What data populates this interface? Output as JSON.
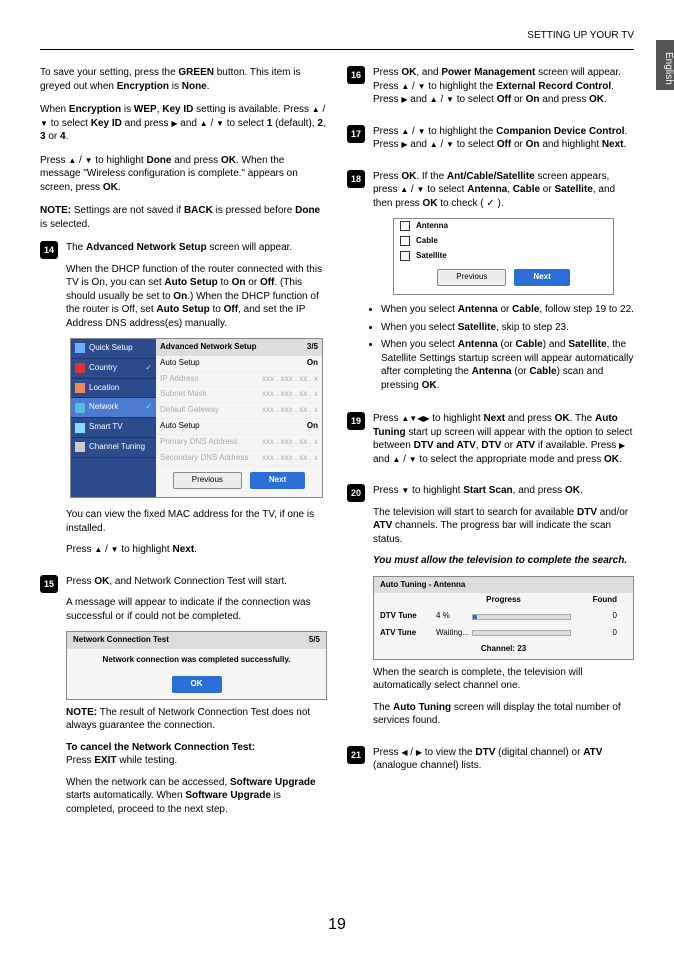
{
  "header": {
    "section": "SETTING UP YOUR TV",
    "lang_tab": "English"
  },
  "left": {
    "p1_a": "To save your setting, press the ",
    "p1_b": " button. This item is greyed out when ",
    "p1_c": " is ",
    "p1_d": ".",
    "green": "GREEN",
    "enc": "Encryption",
    "none": "None",
    "p2_a": "When ",
    "p2_b": " is ",
    "p2_c": ", ",
    "p2_d": " setting is available. Press ",
    "p2_e": " to select ",
    "p2_f": " and press ",
    "p2_g": " and ",
    "p2_h": " to select ",
    "p2_i": " (default), ",
    "p2_j": " or ",
    "p2_k": ".",
    "wep": "WEP",
    "keyid": "Key ID",
    "one": "1",
    "two": "2",
    "three": "3",
    "four": "4",
    "p3_a": "Press ",
    "p3_b": " to highlight ",
    "p3_c": " and press ",
    "p3_d": ". When the message \"Wireless configuration is complete.\" appears on screen, press ",
    "p3_e": ".",
    "done": "Done",
    "ok": "OK",
    "p4_a": "NOTE:",
    "p4_b": " Settings are not saved if ",
    "p4_c": " is pressed before ",
    "p4_d": " is selected.",
    "back": "BACK",
    "s14_a": "The ",
    "s14_b": " screen will appear.",
    "ans": "Advanced Network Setup",
    "p5_a": "When the DHCP function of the router connected with this TV is On, you can set ",
    "p5_b": " to ",
    "p5_c": " or ",
    "p5_d": ". (This should usually be set to ",
    "p5_e": ".) When the DHCP function of the router is Off, set ",
    "p5_f": " to ",
    "p5_g": ", and set the IP Address DNS address(es) manually.",
    "autosetup": "Auto Setup",
    "on": "On",
    "off": "Off",
    "table": {
      "sidebar": [
        {
          "label": "Quick Setup"
        },
        {
          "label": "Country"
        },
        {
          "label": "Location"
        },
        {
          "label": "Network",
          "active": true
        },
        {
          "label": "Smart TV"
        },
        {
          "label": "Channel Tuning"
        }
      ],
      "title": "Advanced Network Setup",
      "page": "3/5",
      "rows": [
        {
          "l": "Auto Setup",
          "r": "On"
        },
        {
          "l": "IP Address",
          "r": "xxx . xxx . xx . x",
          "grey": true
        },
        {
          "l": "Subnet Mask",
          "r": "xxx . xxx . xx . x",
          "grey": true
        },
        {
          "l": "Default Gateway",
          "r": "xxx . xxx . xx . x",
          "grey": true
        },
        {
          "l": "Auto Setup",
          "r": "On"
        },
        {
          "l": "Primary DNS Address",
          "r": "xxx . xxx . xx . x",
          "grey": true
        },
        {
          "l": "Secondary DNS Address",
          "r": "xxx . xxx . xx . x",
          "grey": true
        }
      ],
      "prev": "Previous",
      "next": "Next"
    },
    "p6": "You can view the fixed MAC address for the TV, if one is installed.",
    "p7_a": "Press ",
    "p7_b": " to highlight ",
    "p7_c": ".",
    "next": "Next",
    "s15_a": "Press ",
    "s15_b": ", and Network Connection Test will start.",
    "p8": "A message will appear to indicate if the connection was successful or if could not be completed.",
    "ntest": {
      "title": "Network Connection Test",
      "page": "5/5",
      "msg": "Network connection was completed successfully.",
      "ok": "OK"
    },
    "p9_a": "NOTE:",
    "p9_b": " The result of Network Connection Test does not always guarantee the connection.",
    "p10_a": "To cancel the Network Connection Test:",
    "p10_b": "Press ",
    "p10_c": " while testing.",
    "exit": "EXIT",
    "p11_a": "When the network can be accessed, ",
    "p11_b": " starts automatically. When ",
    "p11_c": " is completed, proceed to the next step.",
    "swu": "Software Upgrade"
  },
  "right": {
    "s16_a": "Press ",
    "s16_b": ", and ",
    "s16_c": " screen will appear. Press ",
    "s16_d": " to highlight the ",
    "s16_e": ". Press ",
    "s16_f": " and ",
    "s16_g": " to select ",
    "s16_h": " or ",
    "s16_i": " and press ",
    "s16_j": ".",
    "pm": "Power Management",
    "erc": "External Record Control",
    "s17_a": "Press ",
    "s17_b": " to highlight the ",
    "s17_c": ". Press ",
    "s17_d": " and ",
    "s17_e": " to select ",
    "s17_f": " or ",
    "s17_g": " and highlight ",
    "s17_h": ".",
    "cdc": "Companion Device Control",
    "s18_a": "Press ",
    "s18_b": ". If the ",
    "s18_c": " screen appears, press ",
    "s18_d": " to select ",
    "s18_e": ", ",
    "s18_f": " or ",
    "s18_g": ", and then press ",
    "s18_h": " to check ( ",
    "s18_i": " ).",
    "acs": "Ant/Cable/Satellite",
    "ant": "Antenna",
    "cable": "Cable",
    "sat": "Satellite",
    "choice": {
      "items": [
        "Antenna",
        "Cable",
        "Satellite"
      ],
      "prev": "Previous",
      "next": "Next"
    },
    "b1_a": "When you select ",
    "b1_b": " or ",
    "b1_c": ", follow step 19 to 22.",
    "b2_a": "When you select ",
    "b2_b": ", skip to step 23.",
    "b3_a": "When you select ",
    "b3_b": " (or ",
    "b3_c": ") and ",
    "b3_d": ", the Satellite Settings startup screen will appear automatically after completing the ",
    "b3_e": " (or ",
    "b3_f": ") scan and pressing ",
    "b3_g": ".",
    "s19_a": "Press ",
    "s19_b": " to highlight ",
    "s19_c": " and press ",
    "s19_d": ". The ",
    "s19_e": " start up screen will appear with the option to select between ",
    "s19_f": ", ",
    "s19_g": " or ",
    "s19_h": " if available. Press ",
    "s19_i": " and ",
    "s19_j": " to select the appropriate mode and press ",
    "s19_k": ".",
    "at": "Auto Tuning",
    "dtvatv": "DTV and ATV",
    "dtv": "DTV",
    "atv": "ATV",
    "s20_a": "Press ",
    "s20_b": " to highlight ",
    "s20_c": ", and press ",
    "s20_d": ".",
    "ss": "Start Scan",
    "p12_a": "The television will start to search for available ",
    "p12_b": " and/or ",
    "p12_c": " channels. The progress bar will indicate the scan status.",
    "p13": "You must allow the television to complete the search.",
    "autotune": {
      "title": "Auto Tuning - Antenna",
      "h_prog": "Progress",
      "h_found": "Found",
      "r1_l": "DTV Tune",
      "r1_p": "4 %",
      "r1_f": "0",
      "r1_fill": 4,
      "r2_l": "ATV Tune",
      "r2_p": "Waiting...",
      "r2_f": "0",
      "r2_fill": 0,
      "foot": "Channel: 23"
    },
    "p14": "When the search is complete, the television will automatically select channel one.",
    "p15_a": "The ",
    "p15_b": " screen will display the total number of services found.",
    "s21_a": "Press ",
    "s21_b": " to view the ",
    "s21_c": " (digital channel) or ",
    "s21_d": " (analogue channel) lists."
  },
  "page_number": "19"
}
